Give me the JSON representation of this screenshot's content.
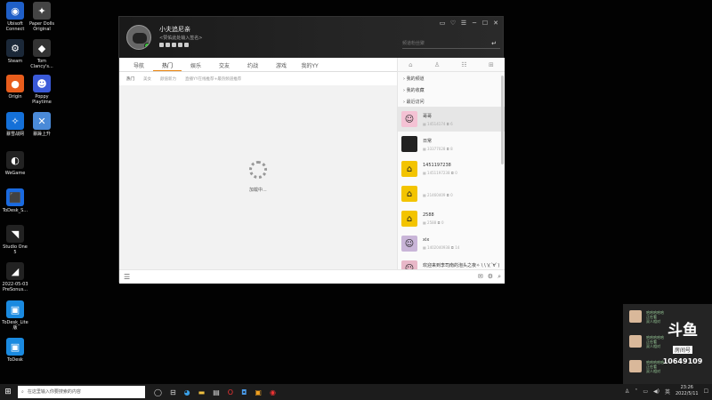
{
  "desktop": {
    "icons": [
      {
        "label": "Ubisoft\nConnect",
        "color": "#1f5fc8",
        "glyph": "◉"
      },
      {
        "label": "Paper Dolls\nOriginal",
        "color": "#444",
        "glyph": "✦"
      },
      {
        "label": "Steam",
        "color": "#1b2838",
        "glyph": "⚙"
      },
      {
        "label": "Tom\nClancy's...",
        "color": "#333",
        "glyph": "◆"
      },
      {
        "label": "Origin",
        "color": "#e85d1c",
        "glyph": "●"
      },
      {
        "label": "Poppy\nPlaytime",
        "color": "#3a5ad8",
        "glyph": "☻"
      },
      {
        "label": "暴雪战网",
        "color": "#1470d8",
        "glyph": "✧"
      },
      {
        "label": "暴躁上升",
        "color": "#4a8ad8",
        "glyph": "✕"
      },
      {
        "label": "WeGame",
        "color": "#222",
        "glyph": "◐"
      },
      {
        "label": "ToDesk_S...",
        "color": "#1a6ae0",
        "glyph": "⬛"
      },
      {
        "label": "Studio One\n5",
        "color": "#222",
        "glyph": "◥"
      },
      {
        "label": "2022-05-03\nPreSonus...",
        "color": "#222",
        "glyph": "◢"
      },
      {
        "label": "ToDesk_Lite\n版",
        "color": "#1a8ae0",
        "glyph": "▣"
      },
      {
        "label": "ToDesk",
        "color": "#1a8ae0",
        "glyph": "▣"
      }
    ]
  },
  "window": {
    "user_name": "小夫追尼亲",
    "signature": "<赞佑此处输入签名>",
    "search_placeholder": "频道粉丝聚",
    "controls": [
      "▭",
      "♡",
      "☰",
      "─",
      "☐",
      "✕"
    ],
    "tabs": [
      "导航",
      "热门",
      "娱乐",
      "交友",
      "约战",
      "游戏",
      "我的YY"
    ],
    "active_tab": "热门",
    "subtabs": [
      "热门",
      "美女",
      "颜值新力",
      "直播YY在线推荐+最热频道推荐"
    ],
    "active_subtab": "热门",
    "refresh_label": "刷新",
    "loading_text": "加载中..."
  },
  "side": {
    "groups": [
      "我的频道",
      "我的收藏",
      "最近访问"
    ],
    "contacts": [
      {
        "name": "哥哥",
        "id": "14514174",
        "count": "6",
        "avatar_color": "#f4c2d4",
        "glyph": "☺",
        "selected": true
      },
      {
        "name": "日常",
        "id": "33377028",
        "count": "8",
        "avatar_color": "#222",
        "glyph": "☻",
        "selected": false
      },
      {
        "name": "1451197238",
        "id": "1451197238",
        "count": "0",
        "avatar_color": "#f3c400",
        "glyph": "⌂",
        "selected": false
      },
      {
        "name": "",
        "id": "21460409",
        "count": "0",
        "avatar_color": "#f3c400",
        "glyph": "⌂",
        "selected": false
      },
      {
        "name": "2588",
        "id": "2588",
        "count": "0",
        "avatar_color": "#f3c400",
        "glyph": "⌂",
        "selected": false
      },
      {
        "name": "xix",
        "id": "1402040938",
        "count": "14",
        "avatar_color": "#c9b5d8",
        "glyph": "☺",
        "selected": false
      },
      {
        "name": "欢迎来到李司南的泡头之夜✧ \\ \\ \\(´∀`)",
        "id": "40717173",
        "count": "138",
        "avatar_color": "#e8b8c8",
        "glyph": "☺",
        "selected": false
      }
    ]
  },
  "notifications": [
    {
      "line1": "哈哈哈哈哈",
      "line2": "正在看",
      "line3": "双人相对"
    },
    {
      "line1": "哈哈哈哈哈",
      "line2": "正在看",
      "line3": "双人相对"
    },
    {
      "line1": "哈哈哈哈哈",
      "line2": "正在看",
      "line3": "双人相对"
    }
  ],
  "brand": {
    "logo": "斗鱼",
    "sub": "房间号",
    "room_number": "10649109"
  },
  "taskbar": {
    "search_placeholder": "在这里输入你要搜索的内容",
    "time": "23:26",
    "date": "2022/5/11",
    "lang": "英"
  }
}
